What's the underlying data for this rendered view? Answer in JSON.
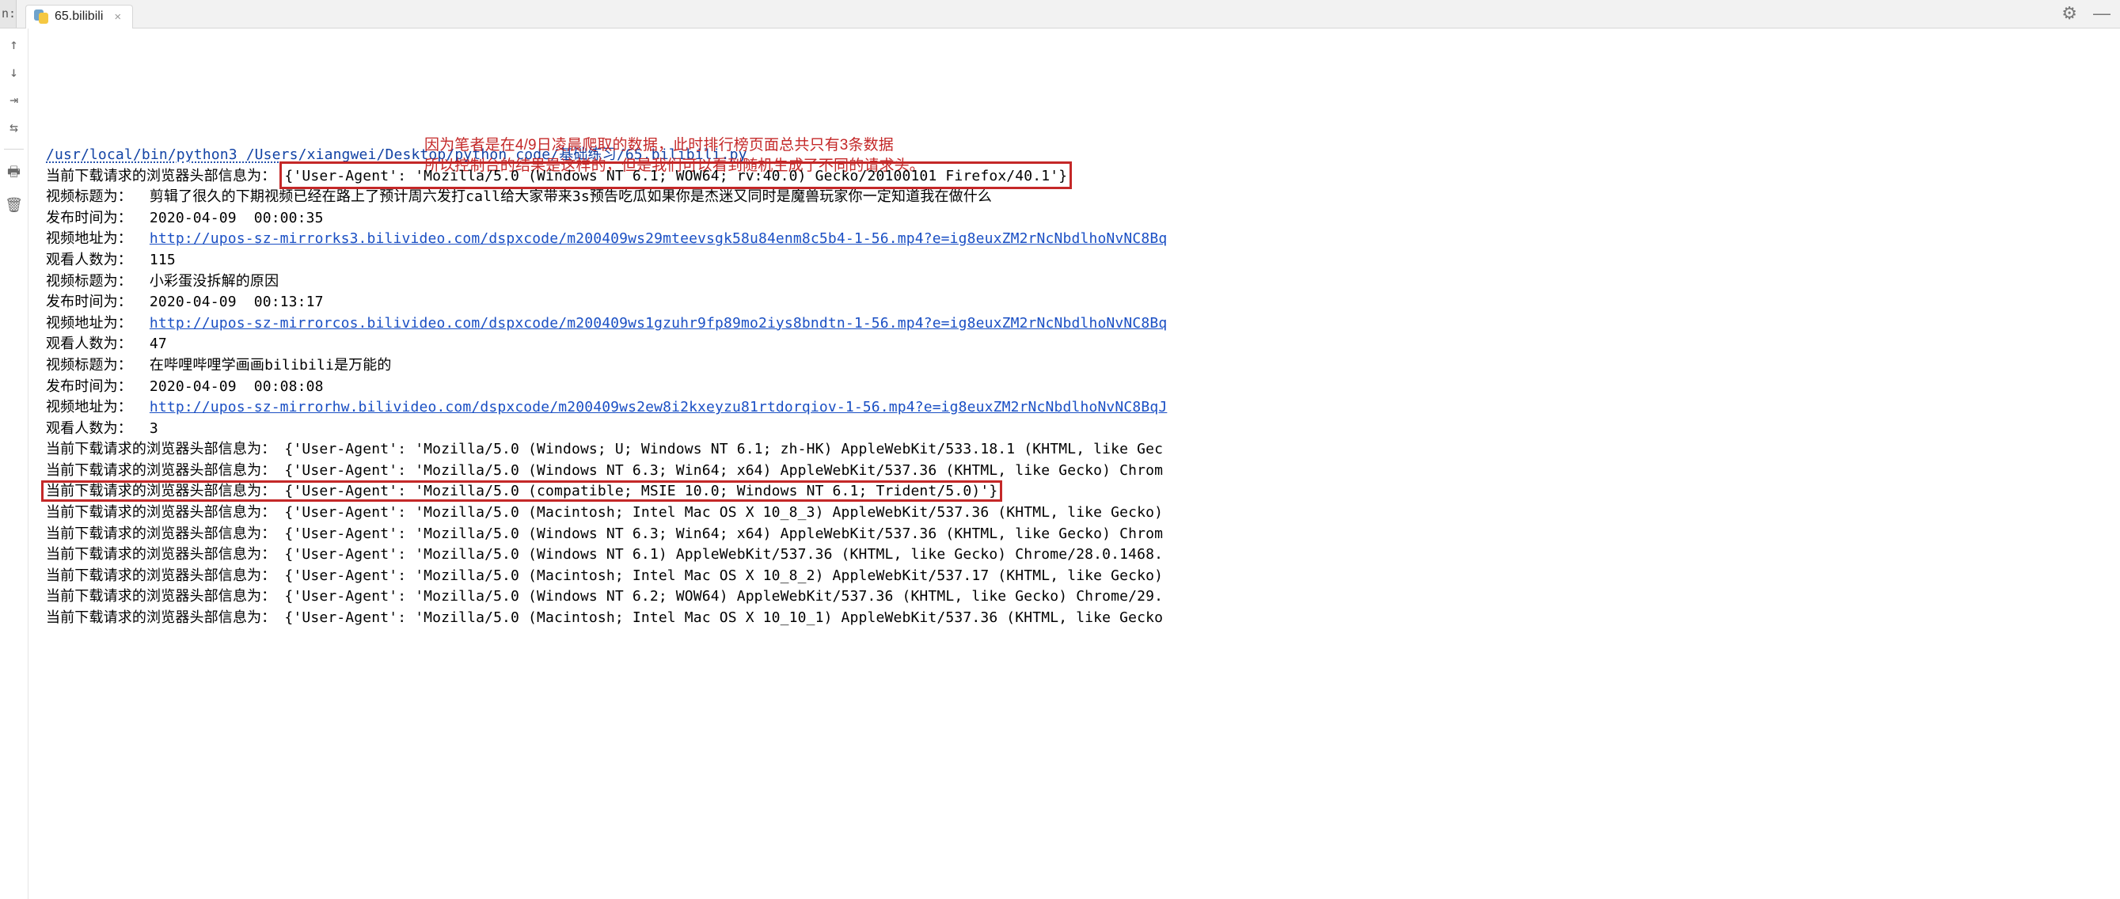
{
  "tabbar": {
    "prefix_label": "n:",
    "tab_label": "65.bilibili",
    "close_glyph": "×",
    "gear_glyph": "⚙",
    "minimize_glyph": "—"
  },
  "gutter": {
    "up": "↑",
    "down": "↓",
    "wrap": "⇥",
    "wrap2": "⇆",
    "print": "🖶",
    "trash": "🗑"
  },
  "annotation": {
    "line1": "因为笔者是在4/9日凌晨爬取的数据，此时排行榜页面总共只有3条数据",
    "line2": "所以控制台的结果是这样的，但是我们可以看到随机生成了不同的请求头。"
  },
  "path": "/usr/local/bin/python3 /Users/xiangwei/Desktop/python code/基础练习/65.bilibili.py",
  "labels": {
    "ua_prefix": "当前下载请求的浏览器头部信息为：",
    "title_prefix": "视频标题为：",
    "time_prefix": "发布时间为：",
    "url_prefix": "视频地址为：",
    "views_prefix": "观看人数为："
  },
  "first_ua": "{'User-Agent': 'Mozilla/5.0 (Windows NT 6.1; WOW64; rv:40.0) Gecko/20100101 Firefox/40.1'}",
  "videos": [
    {
      "title": "剪辑了很久的下期视频已经在路上了预计周六发打call给大家带来3s预告吃瓜如果你是杰迷又同时是魔兽玩家你一定知道我在做什么",
      "time": "2020-04-09  00:00:35",
      "url": "http://upos-sz-mirrorks3.bilivideo.com/dspxcode/m200409ws29mteevsgk58u84enm8c5b4-1-56.mp4?e=ig8euxZM2rNcNbdlhoNvNC8Bq",
      "views": "115"
    },
    {
      "title": "小彩蛋没拆解的原因",
      "time": "2020-04-09  00:13:17",
      "url": "http://upos-sz-mirrorcos.bilivideo.com/dspxcode/m200409ws1gzuhr9fp89mo2iys8bndtn-1-56.mp4?e=ig8euxZM2rNcNbdlhoNvNC8Bq",
      "views": "47"
    },
    {
      "title": "在哔哩哔哩学画画bilibili是万能的",
      "time": "2020-04-09  00:08:08",
      "url": "http://upos-sz-mirrorhw.bilivideo.com/dspxcode/m200409ws2ew8i2kxeyzu81rtdorqiov-1-56.mp4?e=ig8euxZM2rNcNbdlhoNvNC8BqJ",
      "views": "3"
    }
  ],
  "ua_list": [
    "{'User-Agent': 'Mozilla/5.0 (Windows; U; Windows NT 6.1; zh-HK) AppleWebKit/533.18.1 (KHTML, like Gec",
    "{'User-Agent': 'Mozilla/5.0 (Windows NT 6.3; Win64; x64) AppleWebKit/537.36 (KHTML, like Gecko) Chrom",
    "{'User-Agent': 'Mozilla/5.0 (compatible; MSIE 10.0; Windows NT 6.1; Trident/5.0)'}",
    "{'User-Agent': 'Mozilla/5.0 (Macintosh; Intel Mac OS X 10_8_3) AppleWebKit/537.36 (KHTML, like Gecko)",
    "{'User-Agent': 'Mozilla/5.0 (Windows NT 6.3; Win64; x64) AppleWebKit/537.36 (KHTML, like Gecko) Chrom",
    "{'User-Agent': 'Mozilla/5.0 (Windows NT 6.1) AppleWebKit/537.36 (KHTML, like Gecko) Chrome/28.0.1468.",
    "{'User-Agent': 'Mozilla/5.0 (Macintosh; Intel Mac OS X 10_8_2) AppleWebKit/537.17 (KHTML, like Gecko)",
    "{'User-Agent': 'Mozilla/5.0 (Windows NT 6.2; WOW64) AppleWebKit/537.36 (KHTML, like Gecko) Chrome/29.",
    "{'User-Agent': 'Mozilla/5.0 (Macintosh; Intel Mac OS X 10_10_1) AppleWebKit/537.36 (KHTML, like Gecko"
  ]
}
